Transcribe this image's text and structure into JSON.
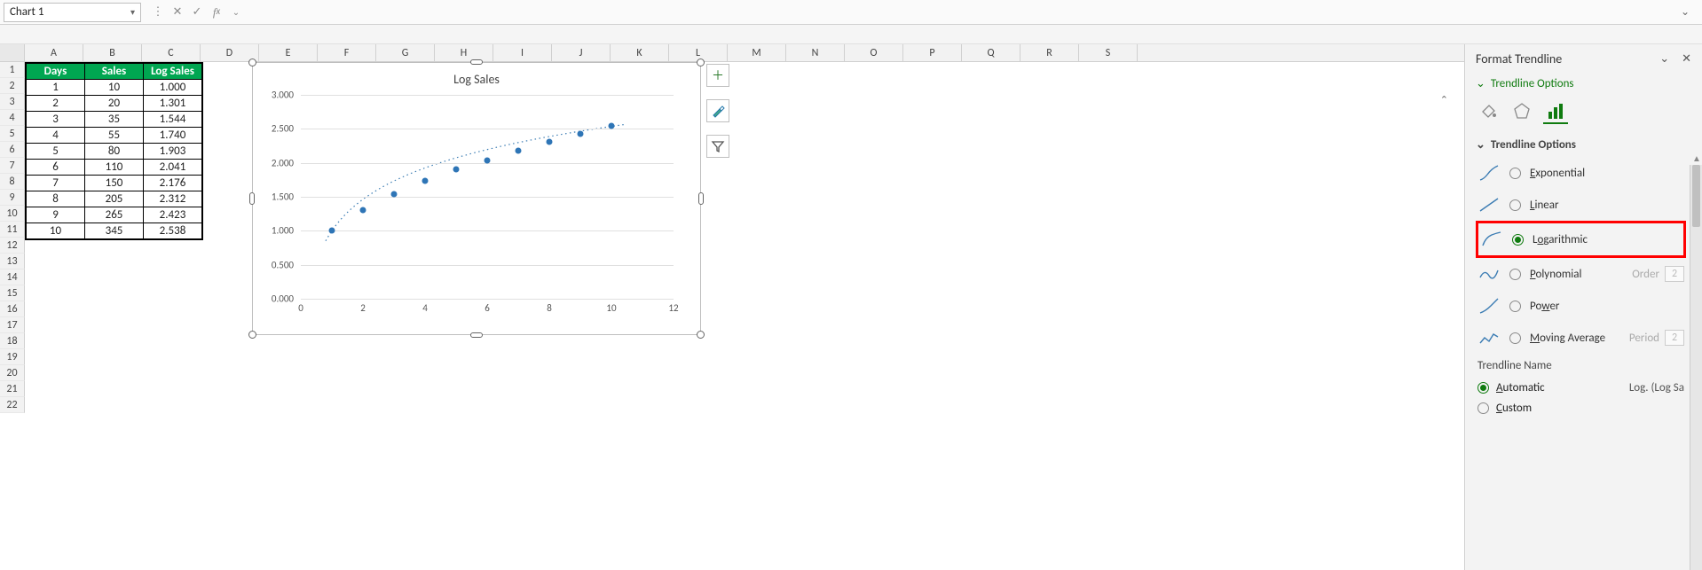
{
  "nameBox": "Chart 1",
  "columns": [
    "A",
    "B",
    "C",
    "D",
    "E",
    "F",
    "G",
    "H",
    "I",
    "J",
    "K",
    "L",
    "M",
    "N",
    "O",
    "P",
    "Q",
    "R",
    "S"
  ],
  "rowCount": 22,
  "table": {
    "headers": [
      "Days",
      "Sales",
      "Log Sales"
    ],
    "rows": [
      [
        "1",
        "10",
        "1.000"
      ],
      [
        "2",
        "20",
        "1.301"
      ],
      [
        "3",
        "35",
        "1.544"
      ],
      [
        "4",
        "55",
        "1.740"
      ],
      [
        "5",
        "80",
        "1.903"
      ],
      [
        "6",
        "110",
        "2.041"
      ],
      [
        "7",
        "150",
        "2.176"
      ],
      [
        "8",
        "205",
        "2.312"
      ],
      [
        "9",
        "265",
        "2.423"
      ],
      [
        "10",
        "345",
        "2.538"
      ]
    ]
  },
  "chart_data": {
    "type": "scatter",
    "title": "Log Sales",
    "xlabel": "",
    "ylabel": "",
    "xlim": [
      0,
      12
    ],
    "ylim": [
      0.0,
      3.0
    ],
    "xticks": [
      0,
      2,
      4,
      6,
      8,
      10,
      12
    ],
    "yticks": [
      "0.000",
      "0.500",
      "1.000",
      "1.500",
      "2.000",
      "2.500",
      "3.000"
    ],
    "series": [
      {
        "name": "Log Sales",
        "x": [
          1,
          2,
          3,
          4,
          5,
          6,
          7,
          8,
          9,
          10
        ],
        "y": [
          1.0,
          1.301,
          1.544,
          1.74,
          1.903,
          2.041,
          2.176,
          2.312,
          2.423,
          2.538
        ]
      }
    ],
    "trendline": {
      "type": "logarithmic"
    }
  },
  "chartButtons": {
    "add": "+",
    "brush": "brush",
    "filter": "filter"
  },
  "pane": {
    "title": "Format Trendline",
    "sub": "Trendline Options",
    "section": "Trendline Options",
    "options": {
      "exponential": "Exponential",
      "linear": "Linear",
      "logarithmic": "Logarithmic",
      "polynomial": "Polynomial",
      "power": "Power",
      "movingavg": "Moving Average",
      "orderLabel": "Order",
      "orderVal": "2",
      "periodLabel": "Period",
      "periodVal": "2"
    },
    "trendlineNameLabel": "Trendline Name",
    "automatic": "Automatic",
    "autoValue": "Log. (Log Sa",
    "custom": "Custom"
  }
}
